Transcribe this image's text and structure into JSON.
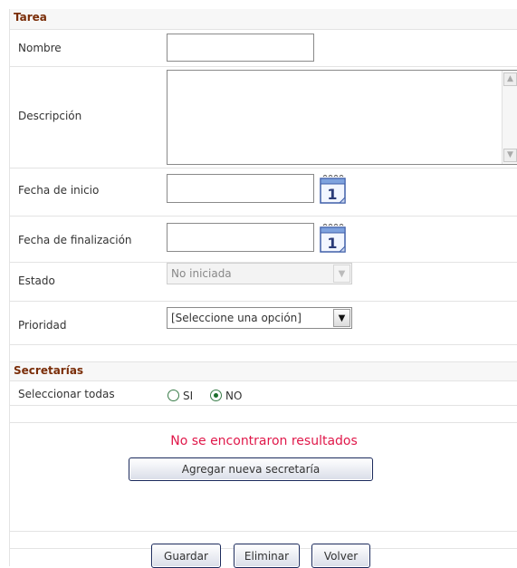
{
  "tarea": {
    "section_title": "Tarea",
    "nombre_label": "Nombre",
    "nombre_value": "",
    "descripcion_label": "Descripción",
    "descripcion_value": "",
    "fecha_inicio_label": "Fecha de inicio",
    "fecha_inicio_value": "",
    "fecha_fin_label": "Fecha de finalización",
    "fecha_fin_value": "",
    "estado_label": "Estado",
    "estado_value": "No iniciada",
    "prioridad_label": "Prioridad",
    "prioridad_value": "[Seleccione una opción]"
  },
  "secretarias": {
    "section_title": "Secretarías",
    "seleccionar_label": "Seleccionar todas",
    "option_si": "SI",
    "option_no": "NO",
    "selected": "NO",
    "no_results": "No se encontraron resultados",
    "add_button": "Agregar nueva secretaría"
  },
  "actions": {
    "guardar": "Guardar",
    "eliminar": "Eliminar",
    "volver": "Volver"
  },
  "icons": {
    "calendar": "calendar-icon",
    "calendar_day": "1",
    "dropdown": "chevron-down-icon"
  },
  "colors": {
    "section_title": "#7a2d08",
    "error_text": "#e0184a",
    "button_border": "#1b2a5c"
  }
}
